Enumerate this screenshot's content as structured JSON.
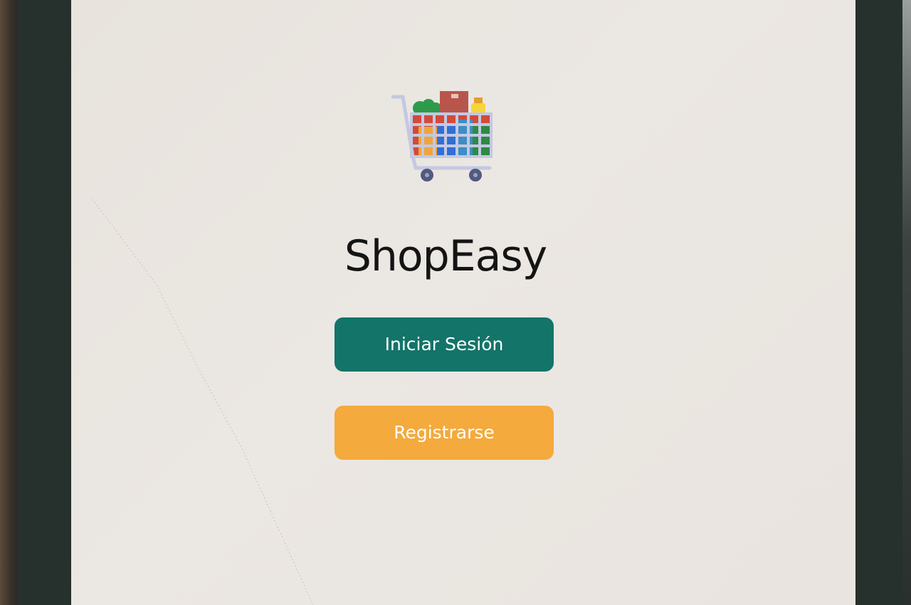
{
  "app": {
    "title": "ShopEasy",
    "logo_icon": "shopping-cart-icon"
  },
  "actions": {
    "login_label": "Iniciar Sesión",
    "register_label": "Registrarse"
  },
  "colors": {
    "background": "#e9e4df",
    "title_text": "#141414",
    "login_button": "#137469",
    "register_button": "#f4aa3c",
    "button_text": "#ffffff",
    "device_frame": "#26302d"
  }
}
